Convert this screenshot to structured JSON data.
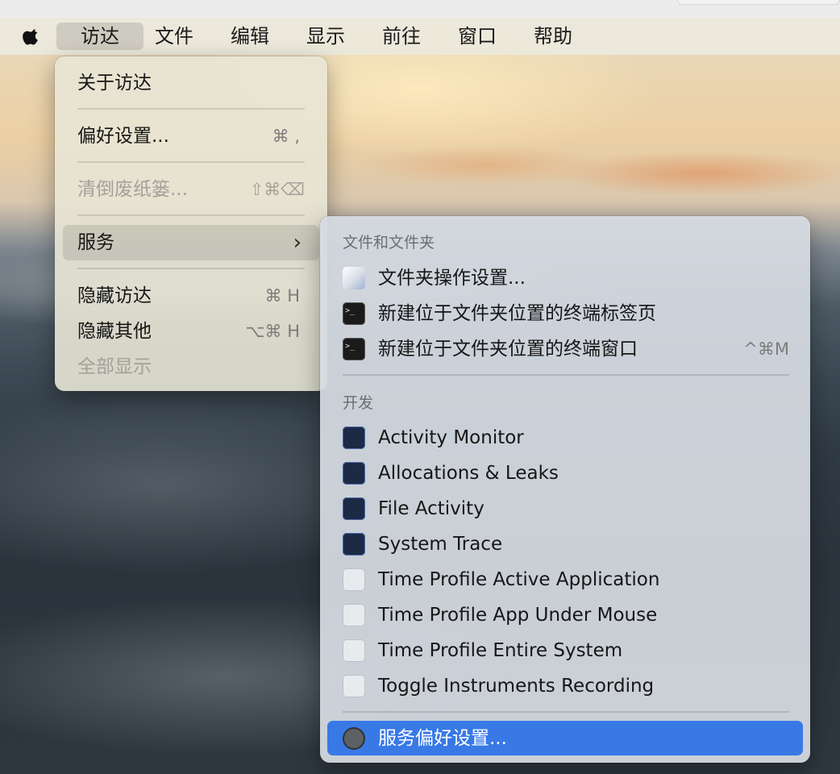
{
  "menubar": {
    "items": [
      "访达",
      "文件",
      "编辑",
      "显示",
      "前往",
      "窗口",
      "帮助"
    ],
    "active_index": 0
  },
  "finder_menu": {
    "items": [
      {
        "label": "关于访达",
        "shortcut": "",
        "enabled": true
      },
      {
        "label": "偏好设置...",
        "shortcut": "⌘ ,",
        "enabled": true
      },
      {
        "label": "清倒废纸篓...",
        "shortcut": "⇧⌘⌫",
        "enabled": false
      },
      {
        "label": "服务",
        "shortcut": "",
        "enabled": true,
        "submenu": true,
        "highlighted": true
      },
      {
        "label": "隐藏访达",
        "shortcut": "⌘ H",
        "enabled": true
      },
      {
        "label": "隐藏其他",
        "shortcut": "⌥⌘ H",
        "enabled": true
      },
      {
        "label": "全部显示",
        "shortcut": "",
        "enabled": false
      }
    ]
  },
  "services_menu": {
    "sections": [
      {
        "title": "文件和文件夹",
        "items": [
          {
            "label": "文件夹操作设置...",
            "icon": "folder-actions-icon",
            "shortcut": ""
          },
          {
            "label": "新建位于文件夹位置的终端标签页",
            "icon": "terminal-icon",
            "shortcut": ""
          },
          {
            "label": "新建位于文件夹位置的终端窗口",
            "icon": "terminal-icon",
            "shortcut": "^⌘M"
          }
        ]
      },
      {
        "title": "开发",
        "items": [
          {
            "label": "Activity Monitor",
            "icon": "instruments-icon",
            "shortcut": ""
          },
          {
            "label": "Allocations & Leaks",
            "icon": "instruments-icon",
            "shortcut": ""
          },
          {
            "label": "File Activity",
            "icon": "instruments-icon",
            "shortcut": ""
          },
          {
            "label": "System Trace",
            "icon": "instruments-icon",
            "shortcut": ""
          },
          {
            "label": "Time Profile Active Application",
            "icon": "instruments-gray-icon",
            "shortcut": ""
          },
          {
            "label": "Time Profile App Under Mouse",
            "icon": "instruments-gray-icon",
            "shortcut": ""
          },
          {
            "label": "Time Profile Entire System",
            "icon": "instruments-gray-icon",
            "shortcut": ""
          },
          {
            "label": "Toggle Instruments Recording",
            "icon": "instruments-gray-icon",
            "shortcut": ""
          }
        ]
      }
    ],
    "footer": {
      "label": "服务偏好设置...",
      "icon": "system-preferences-gear-icon",
      "highlighted": true
    }
  },
  "colors": {
    "selection": "#3879e6",
    "menu_bg": "#e8e5d5"
  }
}
